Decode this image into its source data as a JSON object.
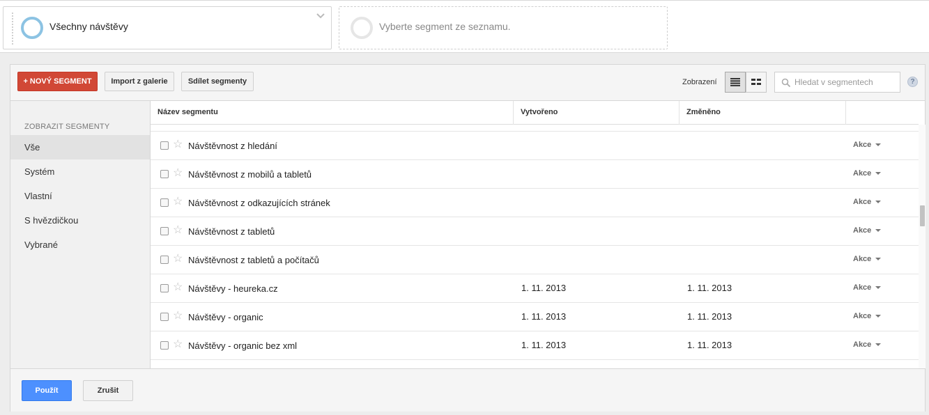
{
  "segments": {
    "active_name": "Všechny návštěvy",
    "empty_placeholder": "Vyberte segment ze seznamu."
  },
  "toolbar": {
    "new_segment": "+ NOVÝ SEGMENT",
    "import_gallery": "Import z galerie",
    "share_segments": "Sdílet segmenty",
    "view_label": "Zobrazení",
    "search_placeholder": "Hledat v segmentech",
    "help": "?"
  },
  "sidebar": {
    "heading": "ZOBRAZIT SEGMENTY",
    "items": [
      "Vše",
      "Systém",
      "Vlastní",
      "S hvězdičkou",
      "Vybrané"
    ],
    "active_index": 0
  },
  "table": {
    "headers": [
      "Název segmentu",
      "Vytvořeno",
      "Změněno",
      ""
    ],
    "rows": [
      {
        "name": "Návštěvnost z hledání",
        "created": "",
        "modified": "",
        "action": "Akce"
      },
      {
        "name": "Návštěvnost z mobilů a tabletů",
        "created": "",
        "modified": "",
        "action": "Akce"
      },
      {
        "name": "Návštěvnost z odkazujících stránek",
        "created": "",
        "modified": "",
        "action": "Akce"
      },
      {
        "name": "Návštěvnost z tabletů",
        "created": "",
        "modified": "",
        "action": "Akce"
      },
      {
        "name": "Návštěvnost z tabletů a počítačů",
        "created": "",
        "modified": "",
        "action": "Akce"
      },
      {
        "name": "Návštěvy - heureka.cz",
        "created": "1. 11. 2013",
        "modified": "1. 11. 2013",
        "action": "Akce"
      },
      {
        "name": "Návštěvy - organic",
        "created": "1. 11. 2013",
        "modified": "1. 11. 2013",
        "action": "Akce"
      },
      {
        "name": "Návštěvy - organic bez xml",
        "created": "1. 11. 2013",
        "modified": "1. 11. 2013",
        "action": "Akce"
      }
    ]
  },
  "footer": {
    "apply": "Použít",
    "cancel": "Zrušit"
  },
  "colors": {
    "primary_red": "#d14836",
    "apply_blue": "#4d90fe",
    "segment_ring": "#8cc3e3"
  }
}
